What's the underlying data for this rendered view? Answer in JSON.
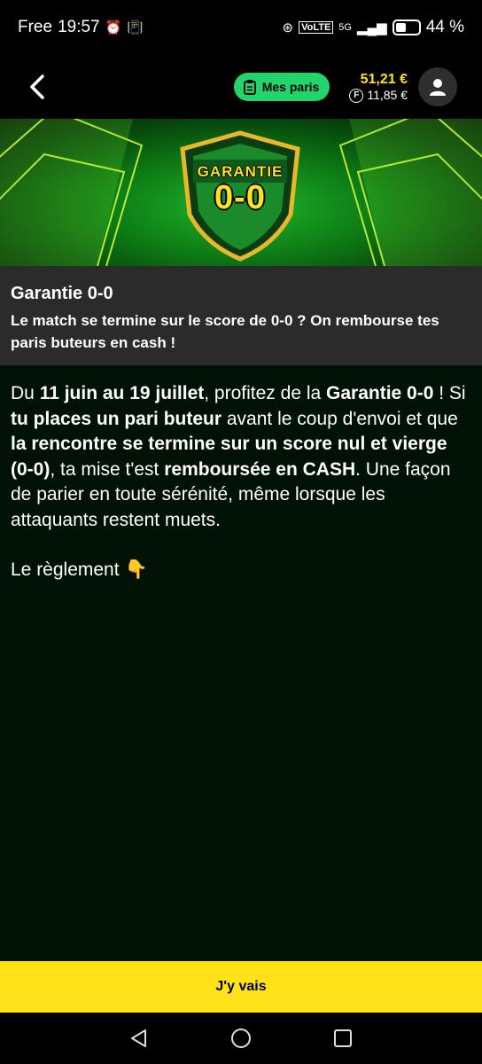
{
  "status_bar": {
    "carrier": "Free",
    "time": "19:57",
    "network": "5G",
    "volte": "VoLTE",
    "battery": "44 %"
  },
  "header": {
    "my_bets_label": "Mes paris",
    "balance": "51,21 €",
    "free_balance": "11,85 €",
    "free_symbol": "F"
  },
  "banner": {
    "badge_title": "GARANTIE",
    "badge_score": "0-0"
  },
  "promo": {
    "title": "Garantie 0-0",
    "subtitle": "Le match se termine sur le score de 0-0 ? On rembourse tes paris buteurs en cash !"
  },
  "description": {
    "p1": "Du ",
    "b1": "11 juin au 19 juillet",
    "p2": ", profitez de la ",
    "b2": "Garantie 0-0",
    "p3": " ! Si ",
    "b3": "tu places un pari buteur",
    "p4": " avant le coup d'envoi et que ",
    "b4": "la rencontre se termine sur un score nul et vierge (0-0)",
    "p5": ", ta mise t'est ",
    "b5": "remboursée en CASH",
    "p6": ". Une façon de parier en toute sérénité, même lorsque les attaquants restent muets."
  },
  "rules_link": "Le règlement",
  "rules_emoji": "👇",
  "cta_label": "J'y vais",
  "colors": {
    "accent_yellow": "#ffe21a",
    "accent_green": "#22d46a",
    "background": "#001205"
  }
}
